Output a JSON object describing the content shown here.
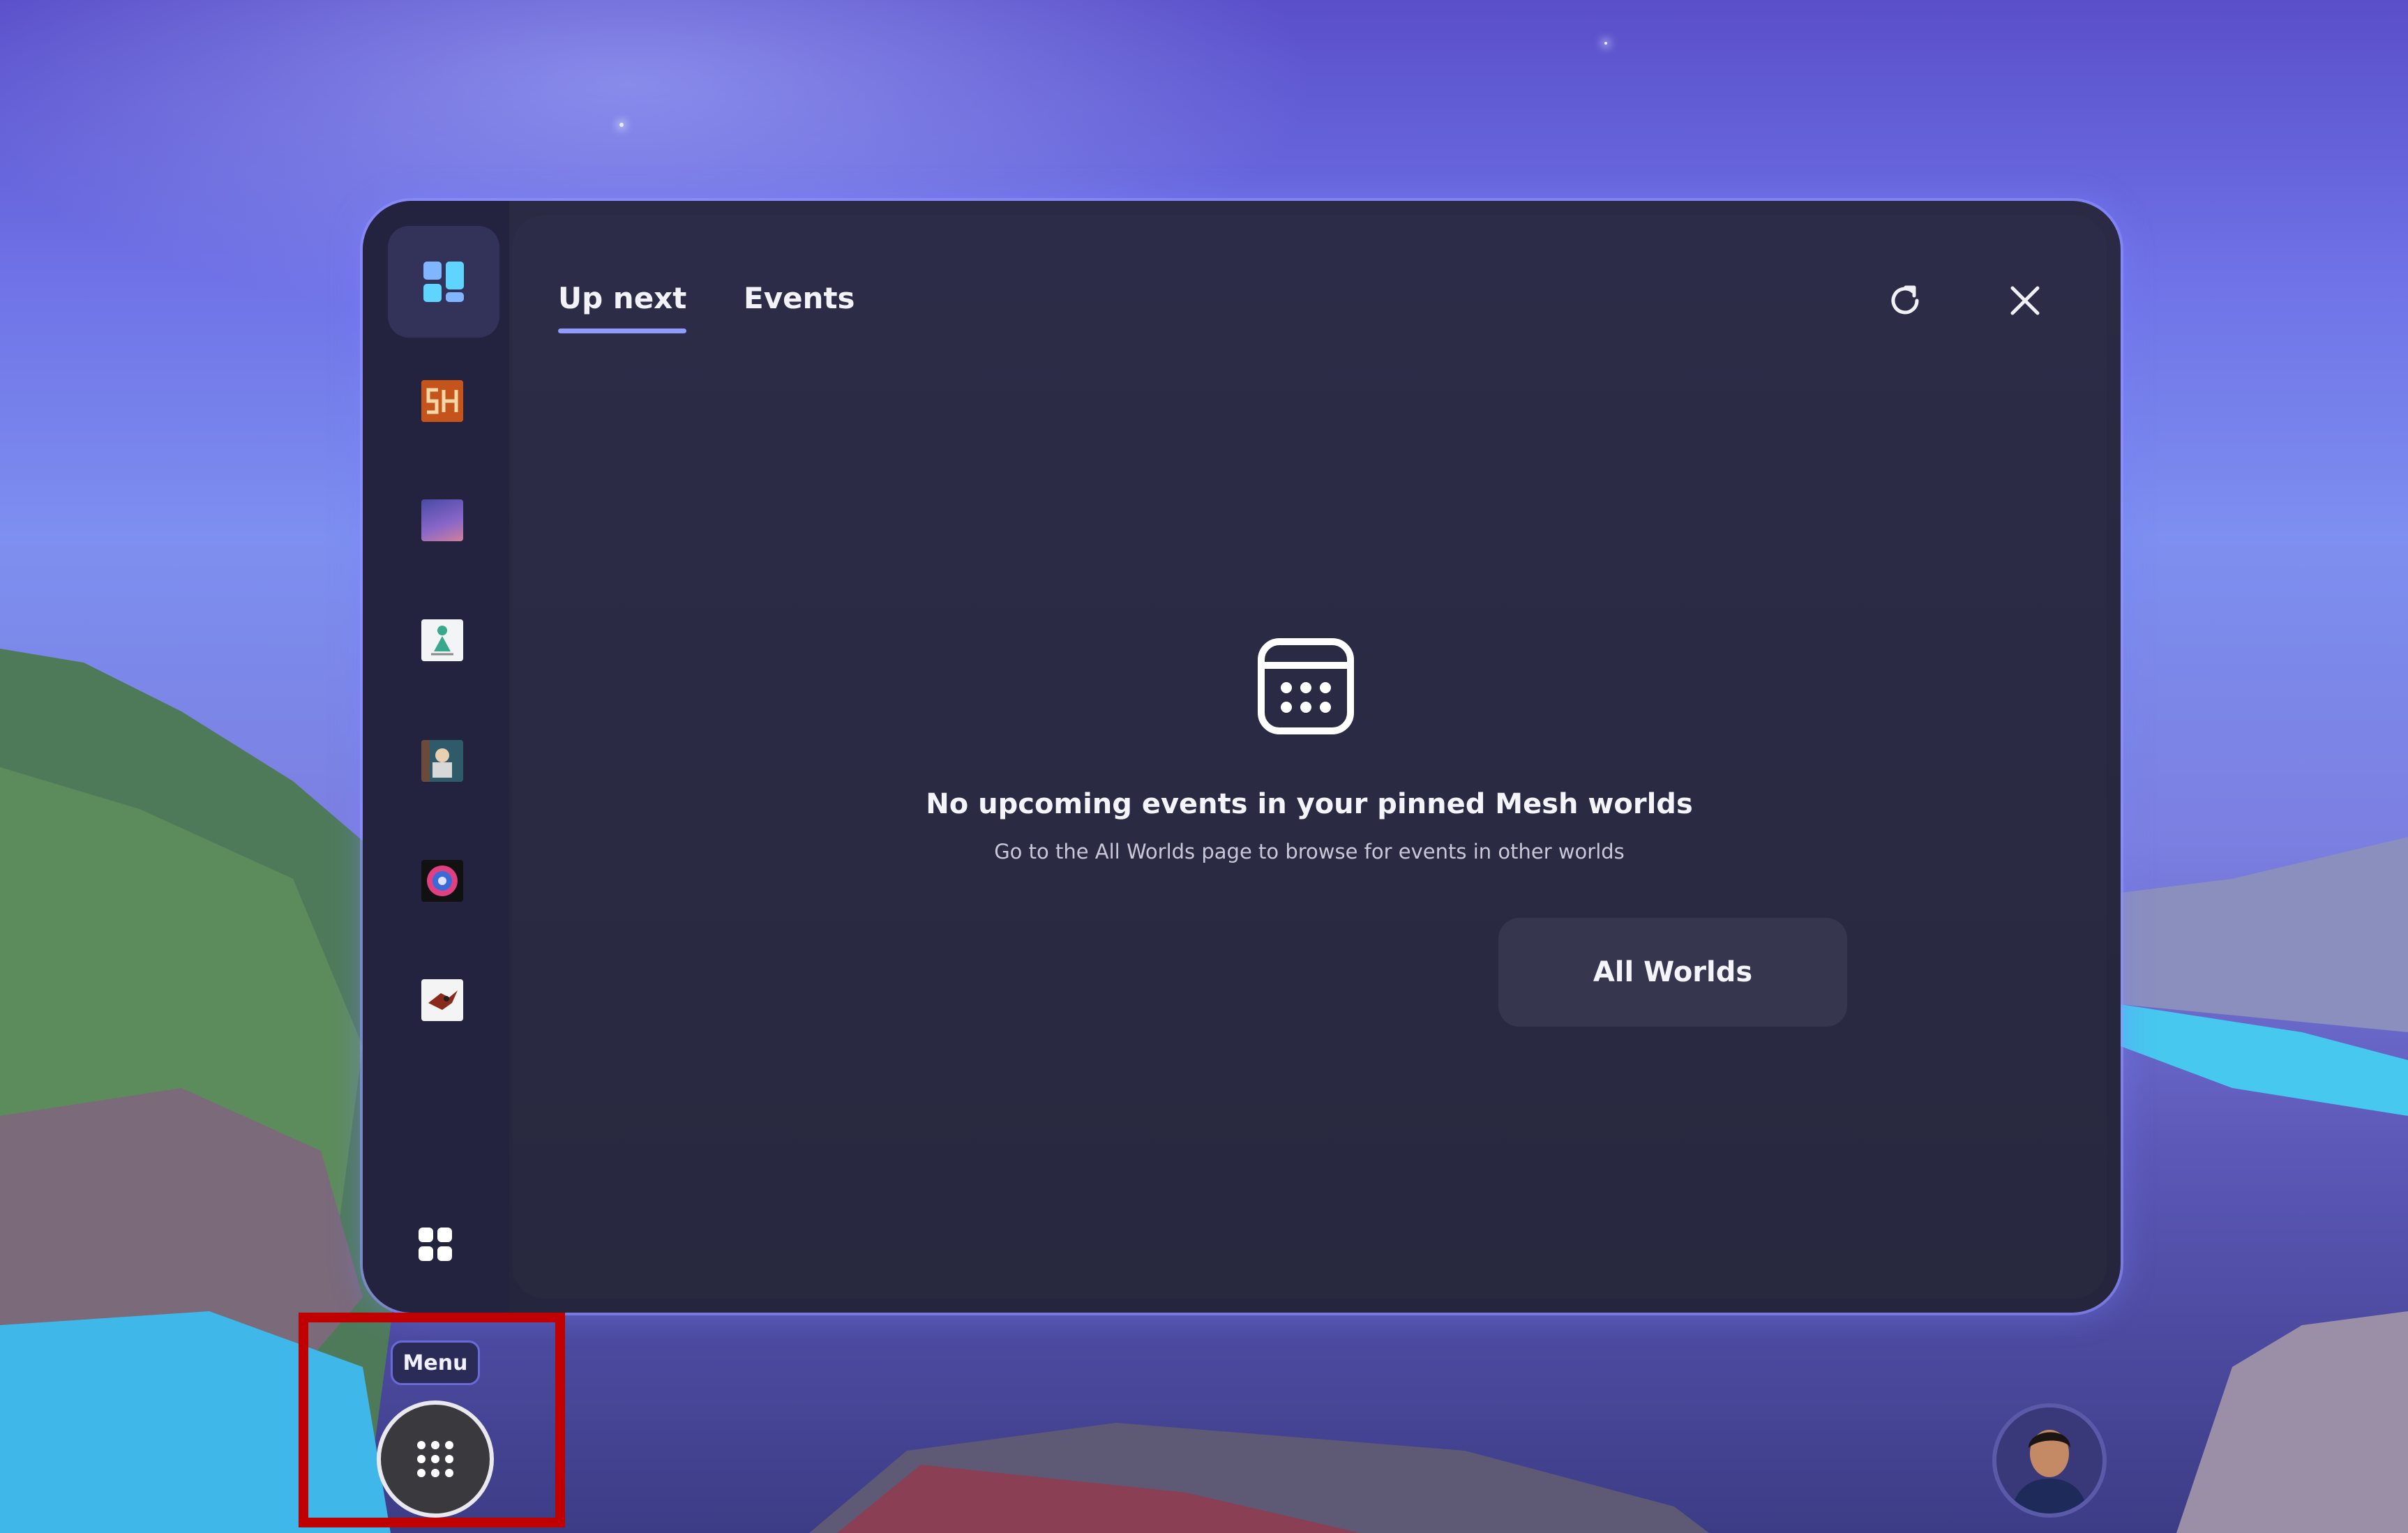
{
  "tabs": [
    {
      "label": "Up next",
      "selected": true
    },
    {
      "label": "Events",
      "selected": false
    }
  ],
  "sidebar": {
    "worlds": [
      {
        "icon": "world-sh-icon"
      },
      {
        "icon": "world-gradient-icon"
      },
      {
        "icon": "world-figure-icon"
      },
      {
        "icon": "world-photo-icon"
      },
      {
        "icon": "world-circle-icon"
      },
      {
        "icon": "world-bird-icon"
      }
    ]
  },
  "empty_state": {
    "title": "No upcoming events in your pinned Mesh worlds",
    "subtitle": "Go to the All Worlds page to browse for events in other worlds",
    "button_label": "All Worlds"
  },
  "menu": {
    "tooltip": "Menu"
  },
  "colors": {
    "accent": "#8f9bff",
    "panel": "#28283f",
    "highlight": "#c00000"
  }
}
